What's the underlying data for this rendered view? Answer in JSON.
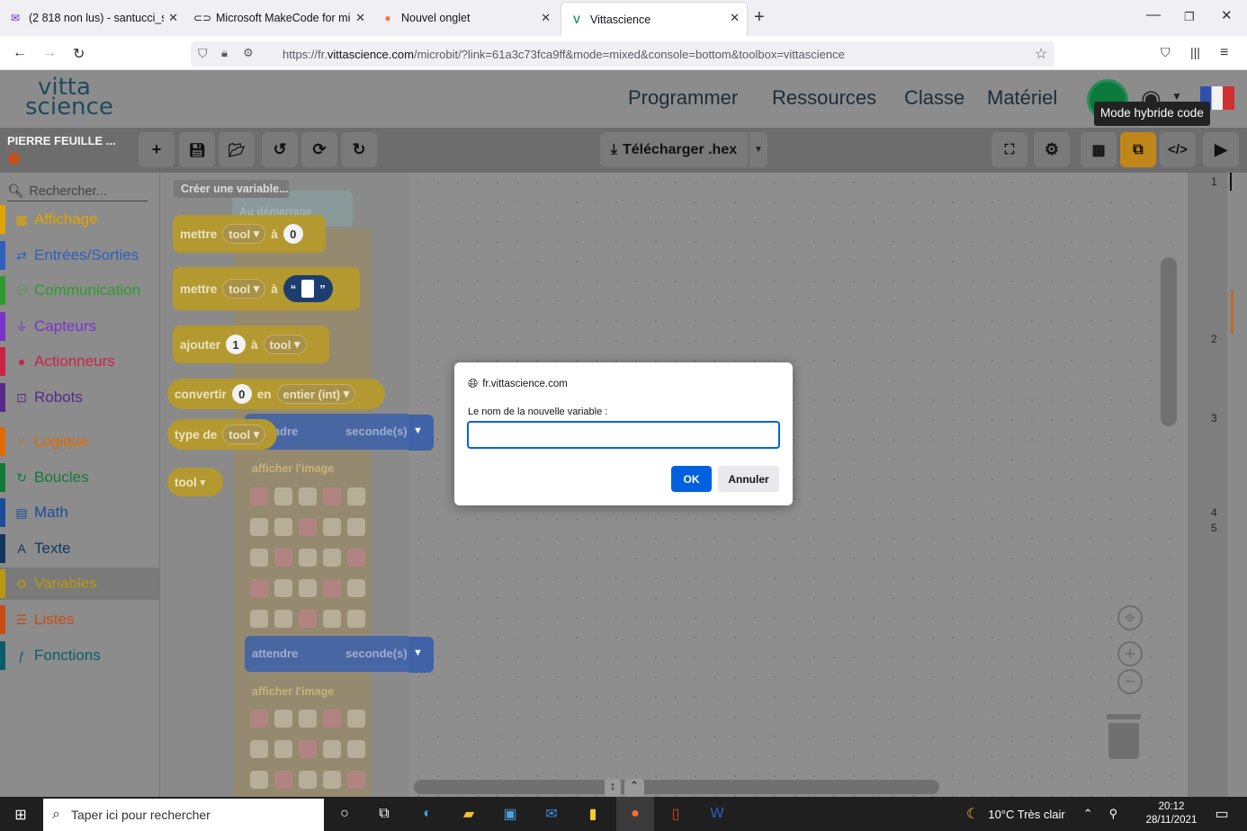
{
  "browser": {
    "tabs": [
      {
        "label": "(2 818 non lus) - santucci_steph",
        "icon": "mail-icon"
      },
      {
        "label": "Microsoft MakeCode for micro:",
        "icon": "makecode-icon"
      },
      {
        "label": "Nouvel onglet",
        "icon": "firefox-icon"
      },
      {
        "label": "Vittascience",
        "icon": "vittascience-icon"
      }
    ],
    "url_prefix": "https://fr.",
    "url_domain": "vittascience.com",
    "url_rest": "/microbit/?link=61a3c73fca9ff&mode=mixed&console=bottom&toolbox=vittascience"
  },
  "site": {
    "logo_top": "vitta",
    "logo_bottom": "science",
    "menu": [
      "Programmer",
      "Ressources",
      "Classe",
      "Matériel"
    ],
    "tooltip": "Mode hybride code"
  },
  "toolbar": {
    "project_name": "PIERRE FEUILLE ...",
    "download_label": "Télécharger .hex"
  },
  "sidebar": {
    "search_placeholder": "Rechercher...",
    "categories": [
      {
        "label": "Affichage",
        "color": "#e0a400",
        "icon": "grid-icon"
      },
      {
        "label": "Entrées/Sorties",
        "color": "#2f5fbf",
        "icon": "arrows-icon"
      },
      {
        "label": "Communication",
        "color": "#2e9b2e",
        "icon": "chat-icon"
      },
      {
        "label": "Capteurs",
        "color": "#7a33cc",
        "icon": "plug-icon"
      },
      {
        "label": "Actionneurs",
        "color": "#cc2244",
        "icon": "bulb-icon"
      },
      {
        "label": "Robots",
        "color": "#5a2a8a",
        "icon": "robot-icon"
      },
      {
        "label": "Logique",
        "color": "#e06a00",
        "icon": "branch-icon"
      },
      {
        "label": "Boucles",
        "color": "#0f7a3a",
        "icon": "loop-icon"
      },
      {
        "label": "Math",
        "color": "#1c4c9c",
        "icon": "calculator-icon"
      },
      {
        "label": "Texte",
        "color": "#13365e",
        "icon": "text-icon"
      },
      {
        "label": "Variables",
        "color": "#b89810",
        "icon": "gear-icon"
      },
      {
        "label": "Listes",
        "color": "#cc4a14",
        "icon": "list-icon"
      },
      {
        "label": "Fonctions",
        "color": "#0a5e6a",
        "icon": "function-icon"
      }
    ]
  },
  "flyout": {
    "create_variable": "Créer une variable...",
    "set_label": "mettre",
    "to_label": "à",
    "var_name": "tool",
    "zero": "0",
    "one": "1",
    "add_label": "ajouter",
    "convert_label": "convertir",
    "in_label": "en",
    "int_type": "entier (int)",
    "type_label": "type de",
    "quote_open": "“",
    "quote_close": "”"
  },
  "workspace_bg": {
    "on_start": "Au démarrage",
    "wait": "attendre",
    "seconds": "seconde(s)",
    "show_image": "afficher l'image"
  },
  "code_lines": [
    "1",
    "2",
    "3",
    "4",
    "5"
  ],
  "dialog": {
    "site": "fr.vittascience.com",
    "label": "Le nom de la nouvelle variable :",
    "value": "",
    "ok": "OK",
    "cancel": "Annuler"
  },
  "taskbar": {
    "search_placeholder": "Taper ici pour rechercher",
    "weather": "10°C  Très clair",
    "time": "20:12",
    "date": "28/11/2021"
  }
}
